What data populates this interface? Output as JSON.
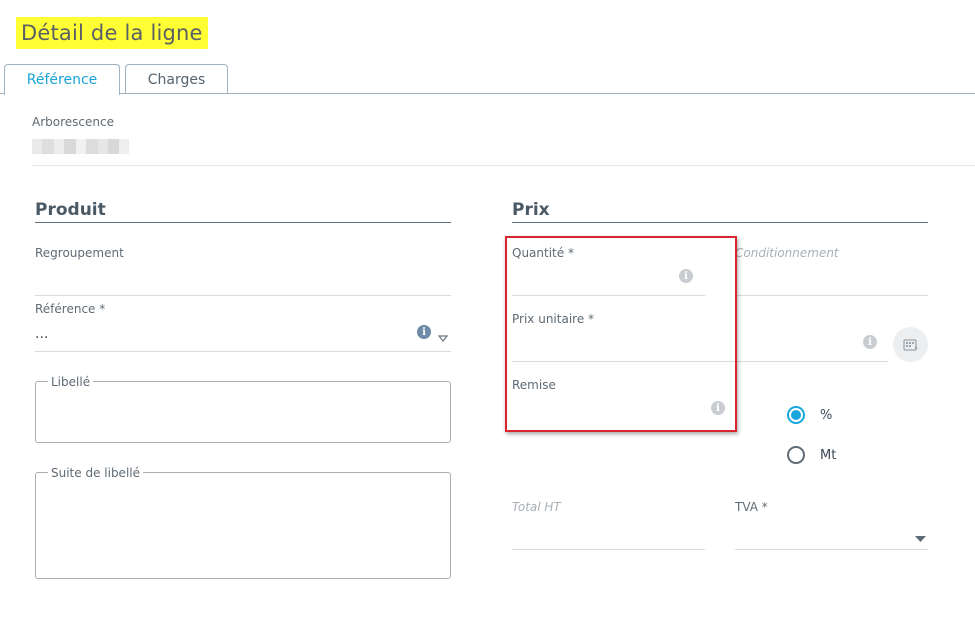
{
  "header": {
    "title": "Détail de la ligne"
  },
  "tabs": [
    {
      "label": "Référence",
      "active": true
    },
    {
      "label": "Charges",
      "active": false
    }
  ],
  "arborescence": {
    "label": "Arborescence"
  },
  "produit": {
    "title": "Produit",
    "regroupement_label": "Regroupement",
    "reference_label": "Référence *",
    "reference_value": "...",
    "libelle_label": "Libellé",
    "suite_libelle_label": "Suite de libellé"
  },
  "prix": {
    "title": "Prix",
    "quantite_label": "Quantité *",
    "conditionnement_label": "Conditionnement",
    "prix_unitaire_label": "Prix unitaire *",
    "remise_label": "Remise",
    "remise_options": [
      {
        "label": "%",
        "selected": true
      },
      {
        "label": "Mt",
        "selected": false
      }
    ],
    "total_ht_label": "Total HT",
    "tva_label": "TVA *"
  },
  "icons": {
    "info": "info-icon",
    "dropdown": "chevron-down-icon",
    "calculator": "calculator-icon"
  },
  "colors": {
    "accent": "#17a7dc",
    "highlight_title": "#ffff33",
    "highlight_box": "#d9262e"
  }
}
